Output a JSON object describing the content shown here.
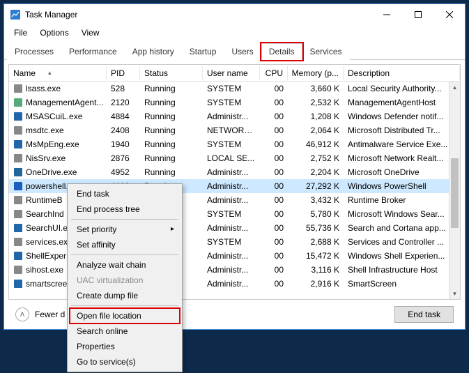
{
  "window": {
    "title": "Task Manager"
  },
  "menubar": {
    "file": "File",
    "options": "Options",
    "view": "View"
  },
  "tabs": {
    "processes": "Processes",
    "performance": "Performance",
    "app_history": "App history",
    "startup": "Startup",
    "users": "Users",
    "details": "Details",
    "services": "Services"
  },
  "columns": {
    "name": "Name",
    "pid": "PID",
    "status": "Status",
    "user": "User name",
    "cpu": "CPU",
    "mem": "Memory (p...",
    "desc": "Description"
  },
  "rows": [
    {
      "name": "lsass.exe",
      "pid": "528",
      "status": "Running",
      "user": "SYSTEM",
      "cpu": "00",
      "mem": "3,660 K",
      "desc": "Local Security Authority..."
    },
    {
      "name": "ManagementAgent...",
      "pid": "2120",
      "status": "Running",
      "user": "SYSTEM",
      "cpu": "00",
      "mem": "2,532 K",
      "desc": "ManagementAgentHost"
    },
    {
      "name": "MSASCuiL.exe",
      "pid": "4884",
      "status": "Running",
      "user": "Administr...",
      "cpu": "00",
      "mem": "1,208 K",
      "desc": "Windows Defender notif..."
    },
    {
      "name": "msdtc.exe",
      "pid": "2408",
      "status": "Running",
      "user": "NETWORK...",
      "cpu": "00",
      "mem": "2,064 K",
      "desc": "Microsoft Distributed Tr..."
    },
    {
      "name": "MsMpEng.exe",
      "pid": "1940",
      "status": "Running",
      "user": "SYSTEM",
      "cpu": "00",
      "mem": "46,912 K",
      "desc": "Antimalware Service Exe..."
    },
    {
      "name": "NisSrv.exe",
      "pid": "2876",
      "status": "Running",
      "user": "LOCAL SE...",
      "cpu": "00",
      "mem": "2,752 K",
      "desc": "Microsoft Network Realt..."
    },
    {
      "name": "OneDrive.exe",
      "pid": "4952",
      "status": "Running",
      "user": "Administr...",
      "cpu": "00",
      "mem": "2,204 K",
      "desc": "Microsoft OneDrive"
    },
    {
      "name": "powershell.exe",
      "pid": "4400",
      "status": "Running",
      "user": "Administr...",
      "cpu": "00",
      "mem": "27,292 K",
      "desc": "Windows PowerShell",
      "selected": true
    },
    {
      "name": "RuntimeB",
      "pid": "",
      "status": "",
      "user": "Administr...",
      "cpu": "00",
      "mem": "3,432 K",
      "desc": "Runtime Broker"
    },
    {
      "name": "SearchInd",
      "pid": "",
      "status": "",
      "user": "SYSTEM",
      "cpu": "00",
      "mem": "5,780 K",
      "desc": "Microsoft Windows Sear..."
    },
    {
      "name": "SearchUI.e",
      "pid": "",
      "status": "",
      "user": "Administr...",
      "cpu": "00",
      "mem": "55,736 K",
      "desc": "Search and Cortana app..."
    },
    {
      "name": "services.ex",
      "pid": "",
      "status": "",
      "user": "SYSTEM",
      "cpu": "00",
      "mem": "2,688 K",
      "desc": "Services and Controller ..."
    },
    {
      "name": "ShellExper",
      "pid": "",
      "status": "",
      "user": "Administr...",
      "cpu": "00",
      "mem": "15,472 K",
      "desc": "Windows Shell Experien..."
    },
    {
      "name": "sihost.exe",
      "pid": "",
      "status": "",
      "user": "Administr...",
      "cpu": "00",
      "mem": "3,116 K",
      "desc": "Shell Infrastructure Host"
    },
    {
      "name": "smartscree",
      "pid": "",
      "status": "",
      "user": "Administr...",
      "cpu": "00",
      "mem": "2,916 K",
      "desc": "SmartScreen"
    }
  ],
  "footer": {
    "fewer": "Fewer d",
    "end_task": "End task"
  },
  "context_menu": {
    "end_task": "End task",
    "end_tree": "End process tree",
    "set_priority": "Set priority",
    "set_affinity": "Set affinity",
    "analyze": "Analyze wait chain",
    "uac": "UAC virtualization",
    "dump": "Create dump file",
    "open_loc": "Open file location",
    "search": "Search online",
    "properties": "Properties",
    "goto_svc": "Go to service(s)"
  }
}
